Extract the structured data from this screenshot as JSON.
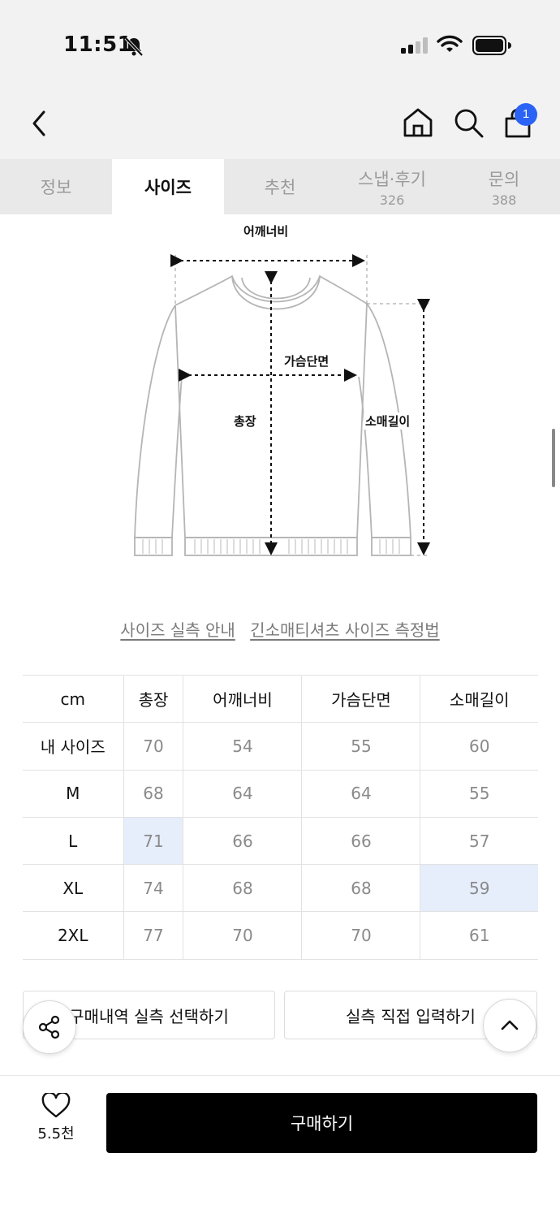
{
  "status_bar": {
    "time": "11:51"
  },
  "header": {
    "cart_count": "1"
  },
  "tabs": [
    {
      "label": "정보",
      "count": ""
    },
    {
      "label": "사이즈",
      "count": ""
    },
    {
      "label": "추천",
      "count": ""
    },
    {
      "label": "스냅·후기",
      "count": "326"
    },
    {
      "label": "문의",
      "count": "388"
    }
  ],
  "diagram": {
    "shoulder": "어깨너비",
    "chest": "가슴단면",
    "length": "총장",
    "sleeve": "소매길이"
  },
  "guide_links": [
    "사이즈 실측 안내",
    "긴소매티셔츠 사이즈 측정법"
  ],
  "size_table": {
    "headers": [
      "cm",
      "총장",
      "어깨너비",
      "가슴단면",
      "소매길이"
    ],
    "rows": [
      [
        "내 사이즈",
        "70",
        "54",
        "55",
        "60"
      ],
      [
        "M",
        "68",
        "64",
        "64",
        "55"
      ],
      [
        "L",
        "71",
        "66",
        "66",
        "57"
      ],
      [
        "XL",
        "74",
        "68",
        "68",
        "59"
      ],
      [
        "2XL",
        "77",
        "70",
        "70",
        "61"
      ]
    ]
  },
  "actions": {
    "purchase_history": "구매내역 실측 선택하기",
    "manual_input": "실측 직접 입력하기"
  },
  "bottom": {
    "like_count": "5.5천",
    "buy_label": "구매하기"
  },
  "colors": {
    "accent": "#2a63f5",
    "highlight": "#e6edfb"
  }
}
